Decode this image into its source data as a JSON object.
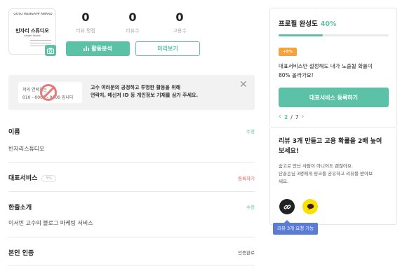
{
  "profile": {
    "avatar_top_text": "GOSU WEB&APP AWARD",
    "avatar_name": "빈자리 스튜디오",
    "avatar_sub": "binjari Studio"
  },
  "stats": [
    {
      "value": "0",
      "label": "리뷰 평점"
    },
    {
      "value": "0",
      "label": "리뷰수"
    },
    {
      "value": "0",
      "label": "고용수"
    }
  ],
  "buttons": {
    "analysis": "활동분석",
    "preview": "미리보기"
  },
  "notice": {
    "card_line1": "저의 연락처는",
    "card_line2": "010 - 0000 - 0000 입니다",
    "text_line1": "고수 여러분의 공정하고 투명한 활동을 위해",
    "text_line2": "연락처, 메신저 ID 등 개인정보 기재를 삼가 주세요."
  },
  "sections": {
    "name": {
      "title": "이름",
      "action": "수정",
      "value": "빈자리스튜디오"
    },
    "service": {
      "title": "대표서비스",
      "tag": "5%",
      "action": "등록하기"
    },
    "intro": {
      "title": "한줄소개",
      "action": "수정",
      "value": "이서빈 고수의 블로그 마케팅 서비스"
    },
    "verify": {
      "title": "본인 인증",
      "action": "인증완료"
    }
  },
  "completion": {
    "title": "프로필 완성도",
    "percent": "40%",
    "progress": 0.4,
    "badge": "+5%",
    "desc_line1": "대표서비스만 설정해도 내가 노출될 확률이",
    "desc_line2": "80% 올라가요!",
    "button": "대표서비스 등록하기",
    "page_current": "2",
    "page_sep": "/",
    "page_total": "7"
  },
  "review": {
    "title_line1": "리뷰 3개 만들고 고용 확률을 2배 높여",
    "title_line2": "보세요!",
    "desc_line1": "숨고로 만난 사람이 아니어도 괜찮아요.",
    "desc_line2": "단골손님 3명에게 링크를 공유하고 리뷰를 받아보",
    "desc_line3": "세요.",
    "tooltip": "리뷰 3개 요청 가능"
  },
  "colors": {
    "accent": "#5bc2a7",
    "badge": "#f7a23b",
    "danger": "#e0545c",
    "tooltip": "#5b7bd5",
    "kakao": "#fae100"
  }
}
